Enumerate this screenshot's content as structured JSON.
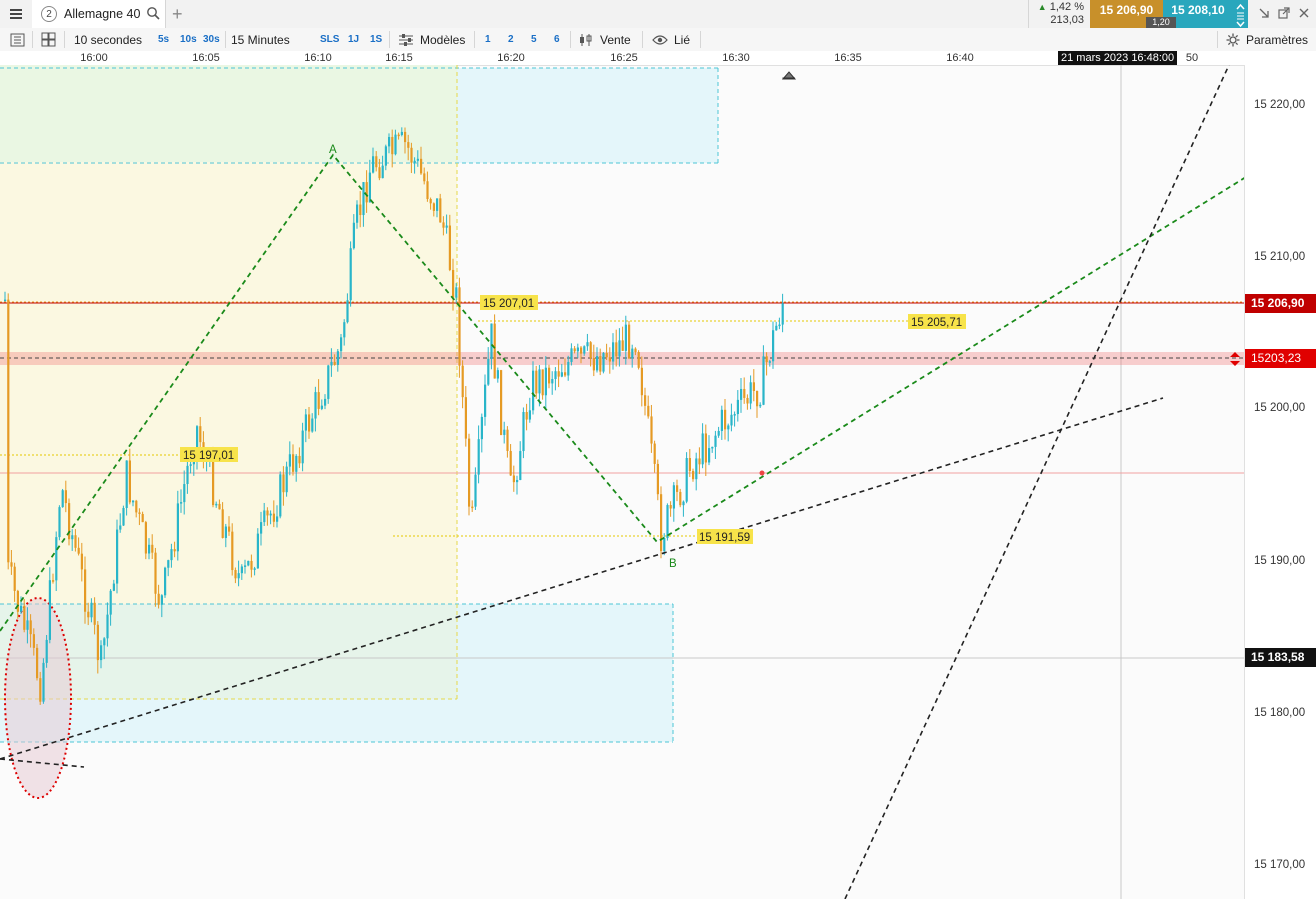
{
  "header": {
    "tab_number": "2",
    "instrument": "Allemagne 40",
    "change_pct": "1,42 %",
    "change_pts": "213,03",
    "bid": "15 206,90",
    "ask": "15 208,10",
    "spread": "1,20"
  },
  "toolbar": {
    "interval": "10 secondes",
    "quick_seconds": [
      "5s",
      "10s",
      "30s"
    ],
    "timeframe": "15 Minutes",
    "quick_periods": [
      "SLS",
      "1J",
      "1S"
    ],
    "templates_label": "Modèles",
    "template_slots": [
      "1",
      "2",
      "5",
      "6"
    ],
    "sell_label": "Vente",
    "linked_label": "Lié",
    "settings_label": "Paramètres"
  },
  "time_axis": {
    "labels": [
      "16:00",
      "16:05",
      "16:10",
      "16:15",
      "16:20",
      "16:25",
      "16:30",
      "16:35",
      "16:40",
      "50"
    ],
    "cursor_label": "21 mars 2023 16:48:00"
  },
  "price_axis": {
    "ticks": [
      "15 220,00",
      "15 210,00",
      "15 200,00",
      "15 190,00",
      "15 180,00",
      "15 170,00"
    ]
  },
  "price_labels": {
    "current": "15 206,90",
    "alert": "15203,23",
    "crosshair": "15 183,58"
  },
  "annotations": {
    "level_high": "15 207,01",
    "level_mid": "15 205,71",
    "level_left": "15 197,01",
    "level_low": "15 191,59",
    "point_a": "A",
    "point_b": "B"
  },
  "colors": {
    "bull_candle": "#29b5c9",
    "bear_candle": "#e59a24",
    "current_price": "#c00000",
    "alert": "#e00000",
    "green_trend": "#1a8a1a",
    "bid_bg": "#c8902a",
    "ask_bg": "#29a7bd"
  }
}
